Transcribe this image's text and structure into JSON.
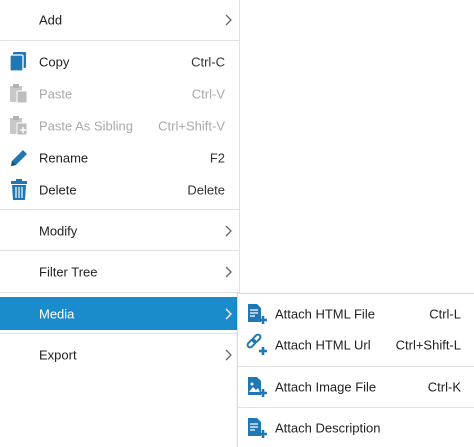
{
  "menu": {
    "items": [
      {
        "label": "Add",
        "shortcut": "",
        "has_submenu": true,
        "icon": "none"
      },
      {
        "label": "Copy",
        "shortcut": "Ctrl-C",
        "icon": "copy-icon"
      },
      {
        "label": "Paste",
        "shortcut": "Ctrl-V",
        "disabled": true,
        "icon": "paste-icon"
      },
      {
        "label": "Paste As Sibling",
        "shortcut": "Ctrl+Shift-V",
        "disabled": true,
        "icon": "paste-sibling-icon"
      },
      {
        "label": "Rename",
        "shortcut": "F2",
        "icon": "pencil-icon"
      },
      {
        "label": "Delete",
        "shortcut": "Delete",
        "icon": "trash-icon"
      },
      {
        "label": "Modify",
        "has_submenu": true
      },
      {
        "label": "Filter Tree",
        "has_submenu": true
      },
      {
        "label": "Media",
        "has_submenu": true,
        "active": true
      },
      {
        "label": "Export",
        "has_submenu": true
      }
    ]
  },
  "submenu": {
    "items": [
      {
        "label": "Attach HTML File",
        "shortcut": "Ctrl-L",
        "icon": "attach-html-file-icon"
      },
      {
        "label": "Attach HTML Url",
        "shortcut": "Ctrl+Shift-L",
        "icon": "attach-url-icon"
      },
      {
        "label": "Attach Image File",
        "shortcut": "Ctrl-K",
        "icon": "attach-image-icon"
      },
      {
        "label": "Attach Description",
        "shortcut": "",
        "icon": "attach-description-icon"
      }
    ]
  },
  "colors": {
    "accent": "#1a8ccb",
    "icon_blue": "#1f77b4",
    "disabled": "#a9a9a9",
    "separator": "#e2e2e2"
  }
}
